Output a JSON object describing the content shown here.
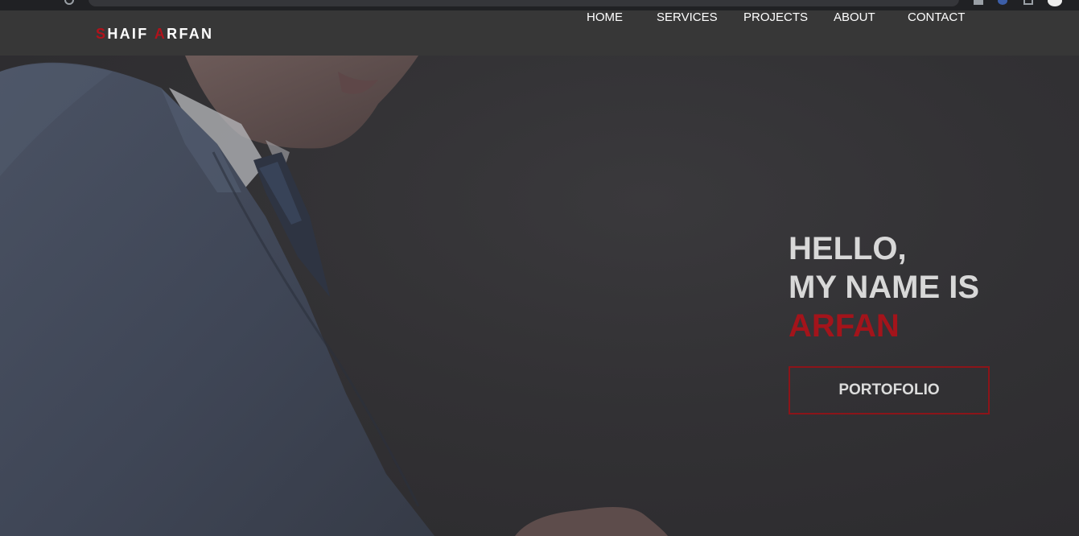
{
  "brand": {
    "first_initial": "S",
    "first_rest": "HAIF",
    "last_initial": "A",
    "last_rest": "RFAN"
  },
  "nav": {
    "items": [
      "HOME",
      "SERVICES",
      "PROJECTS",
      "ABOUT",
      "CONTACT"
    ]
  },
  "hero": {
    "line1": "HELLO,",
    "line2": "MY NAME IS",
    "name": "ARFAN",
    "button_label": "PORTOFOLIO",
    "image_description_icon": "man-in-suit-photo"
  },
  "colors": {
    "accent": "#b1121b",
    "navbar": "#373737",
    "hero_bg": "#323134",
    "text": "#d8d8d8"
  }
}
